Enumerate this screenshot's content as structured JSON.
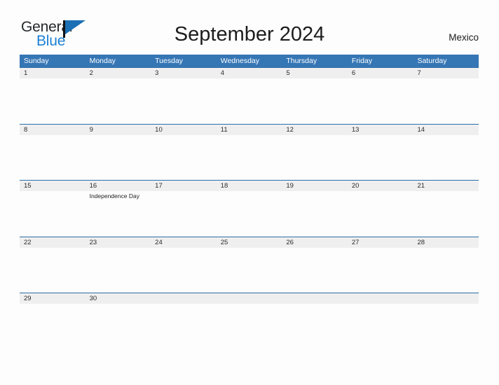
{
  "brand": {
    "word_one": "General",
    "word_two": "Blue",
    "flag_icon": "flag-triangle-icon",
    "accent_dark": "#25282b",
    "accent_blue": "#1b7fd4",
    "flag_blue": "#1b6fb5"
  },
  "header": {
    "title": "September 2024",
    "country": "Mexico"
  },
  "colors": {
    "header_blue": "#3576b5",
    "row_rule_blue": "#2c6ca8",
    "date_band_gray": "#efefef",
    "page_background": "#fdfdfd"
  },
  "calendar": {
    "weekdays": [
      "Sunday",
      "Monday",
      "Tuesday",
      "Wednesday",
      "Thursday",
      "Friday",
      "Saturday"
    ],
    "weeks": [
      {
        "days": [
          {
            "date": "1",
            "events": []
          },
          {
            "date": "2",
            "events": []
          },
          {
            "date": "3",
            "events": []
          },
          {
            "date": "4",
            "events": []
          },
          {
            "date": "5",
            "events": []
          },
          {
            "date": "6",
            "events": []
          },
          {
            "date": "7",
            "events": []
          }
        ]
      },
      {
        "days": [
          {
            "date": "8",
            "events": []
          },
          {
            "date": "9",
            "events": []
          },
          {
            "date": "10",
            "events": []
          },
          {
            "date": "11",
            "events": []
          },
          {
            "date": "12",
            "events": []
          },
          {
            "date": "13",
            "events": []
          },
          {
            "date": "14",
            "events": []
          }
        ]
      },
      {
        "days": [
          {
            "date": "15",
            "events": []
          },
          {
            "date": "16",
            "events": [
              "Independence Day"
            ]
          },
          {
            "date": "17",
            "events": []
          },
          {
            "date": "18",
            "events": []
          },
          {
            "date": "19",
            "events": []
          },
          {
            "date": "20",
            "events": []
          },
          {
            "date": "21",
            "events": []
          }
        ]
      },
      {
        "days": [
          {
            "date": "22",
            "events": []
          },
          {
            "date": "23",
            "events": []
          },
          {
            "date": "24",
            "events": []
          },
          {
            "date": "25",
            "events": []
          },
          {
            "date": "26",
            "events": []
          },
          {
            "date": "27",
            "events": []
          },
          {
            "date": "28",
            "events": []
          }
        ]
      },
      {
        "days": [
          {
            "date": "29",
            "events": []
          },
          {
            "date": "30",
            "events": []
          },
          {
            "date": "",
            "events": []
          },
          {
            "date": "",
            "events": []
          },
          {
            "date": "",
            "events": []
          },
          {
            "date": "",
            "events": []
          },
          {
            "date": "",
            "events": []
          }
        ]
      }
    ]
  }
}
